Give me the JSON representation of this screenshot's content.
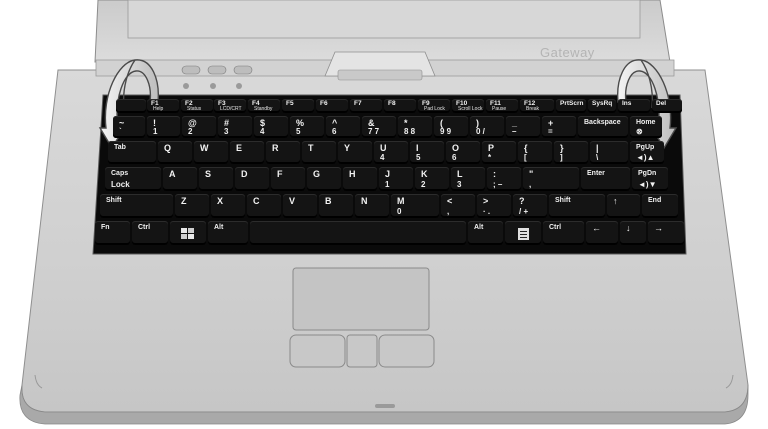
{
  "brand": "Gateway",
  "keyboard": {
    "function_row": [
      {
        "top": "",
        "sub": ""
      },
      {
        "top": "F1",
        "sub": "Help"
      },
      {
        "top": "F2",
        "sub": "Status"
      },
      {
        "top": "F3",
        "sub": "LCD/CRT"
      },
      {
        "top": "F4",
        "sub": "Standby"
      },
      {
        "top": "F5",
        "sub": ""
      },
      {
        "top": "F6",
        "sub": ""
      },
      {
        "top": "F7",
        "sub": ""
      },
      {
        "top": "F8",
        "sub": ""
      },
      {
        "top": "F9",
        "sub": "Pad Lock"
      },
      {
        "top": "F10",
        "sub": "Scroll Lock"
      },
      {
        "top": "F11",
        "sub": "Pause"
      },
      {
        "top": "F12",
        "sub": "Break"
      },
      {
        "top": "PrtScrn",
        "sub": ""
      },
      {
        "top": "SysRq",
        "sub": ""
      },
      {
        "top": "Ins",
        "sub": ""
      },
      {
        "top": "Del",
        "sub": ""
      }
    ],
    "number_row": [
      {
        "top": "~",
        "bottom": "`"
      },
      {
        "top": "!",
        "bottom": "1"
      },
      {
        "top": "@",
        "bottom": "2"
      },
      {
        "top": "#",
        "bottom": "3"
      },
      {
        "top": "$",
        "bottom": "4"
      },
      {
        "top": "%",
        "bottom": "5"
      },
      {
        "top": "^",
        "bottom": "6"
      },
      {
        "top": "&",
        "bottom": "7 7"
      },
      {
        "top": "*",
        "bottom": "8 8"
      },
      {
        "top": "(",
        "bottom": "9 9"
      },
      {
        "top": ")",
        "bottom": "0 /"
      },
      {
        "top": "_",
        "bottom": "–"
      },
      {
        "top": "+",
        "bottom": "="
      },
      {
        "top": "Backspace",
        "bottom": ""
      },
      {
        "top": "Home",
        "bottom": "⊗"
      }
    ],
    "qwerty_row": [
      {
        "top": "Tab",
        "bottom": ""
      },
      {
        "top": "Q",
        "bottom": ""
      },
      {
        "top": "W",
        "bottom": ""
      },
      {
        "top": "E",
        "bottom": ""
      },
      {
        "top": "R",
        "bottom": ""
      },
      {
        "top": "T",
        "bottom": ""
      },
      {
        "top": "Y",
        "bottom": ""
      },
      {
        "top": "U",
        "bottom": "4"
      },
      {
        "top": "I",
        "bottom": "5"
      },
      {
        "top": "O",
        "bottom": "6"
      },
      {
        "top": "P",
        "bottom": "*"
      },
      {
        "top": "{",
        "bottom": "["
      },
      {
        "top": "}",
        "bottom": "]"
      },
      {
        "top": "|",
        "bottom": "\\"
      },
      {
        "top": "PgUp",
        "bottom": "◄)▲"
      }
    ],
    "home_row": [
      {
        "top": "Caps",
        "bottom": "Lock"
      },
      {
        "top": "A",
        "bottom": ""
      },
      {
        "top": "S",
        "bottom": ""
      },
      {
        "top": "D",
        "bottom": ""
      },
      {
        "top": "F",
        "bottom": ""
      },
      {
        "top": "G",
        "bottom": ""
      },
      {
        "top": "H",
        "bottom": ""
      },
      {
        "top": "J",
        "bottom": "1"
      },
      {
        "top": "K",
        "bottom": "2"
      },
      {
        "top": "L",
        "bottom": "3"
      },
      {
        "top": ":",
        "bottom": ";  –"
      },
      {
        "top": "\"",
        "bottom": ","
      },
      {
        "top": "Enter",
        "bottom": ""
      },
      {
        "top": "PgDn",
        "bottom": "◄)▼"
      }
    ],
    "shift_row": [
      {
        "top": "Shift",
        "bottom": ""
      },
      {
        "top": "Z",
        "bottom": ""
      },
      {
        "top": "X",
        "bottom": ""
      },
      {
        "top": "C",
        "bottom": ""
      },
      {
        "top": "V",
        "bottom": ""
      },
      {
        "top": "B",
        "bottom": ""
      },
      {
        "top": "N",
        "bottom": ""
      },
      {
        "top": "M",
        "bottom": "0"
      },
      {
        "top": "<",
        "bottom": ","
      },
      {
        "top": ">",
        "bottom": "·  ."
      },
      {
        "top": "?",
        "bottom": "/ +"
      },
      {
        "top": "Shift",
        "bottom": ""
      },
      {
        "top": "↑",
        "bottom": ""
      },
      {
        "top": "End",
        "bottom": ""
      }
    ],
    "bottom_row": [
      {
        "top": "Fn",
        "bottom": ""
      },
      {
        "top": "Ctrl",
        "bottom": ""
      },
      {
        "top": "",
        "bottom": ""
      },
      {
        "top": "Alt",
        "bottom": ""
      },
      {
        "top": "",
        "bottom": ""
      },
      {
        "top": "Alt",
        "bottom": ""
      },
      {
        "top": "",
        "bottom": ""
      },
      {
        "top": "Ctrl",
        "bottom": ""
      },
      {
        "top": "←",
        "bottom": ""
      },
      {
        "top": "↓",
        "bottom": ""
      },
      {
        "top": "→",
        "bottom": ""
      }
    ]
  }
}
